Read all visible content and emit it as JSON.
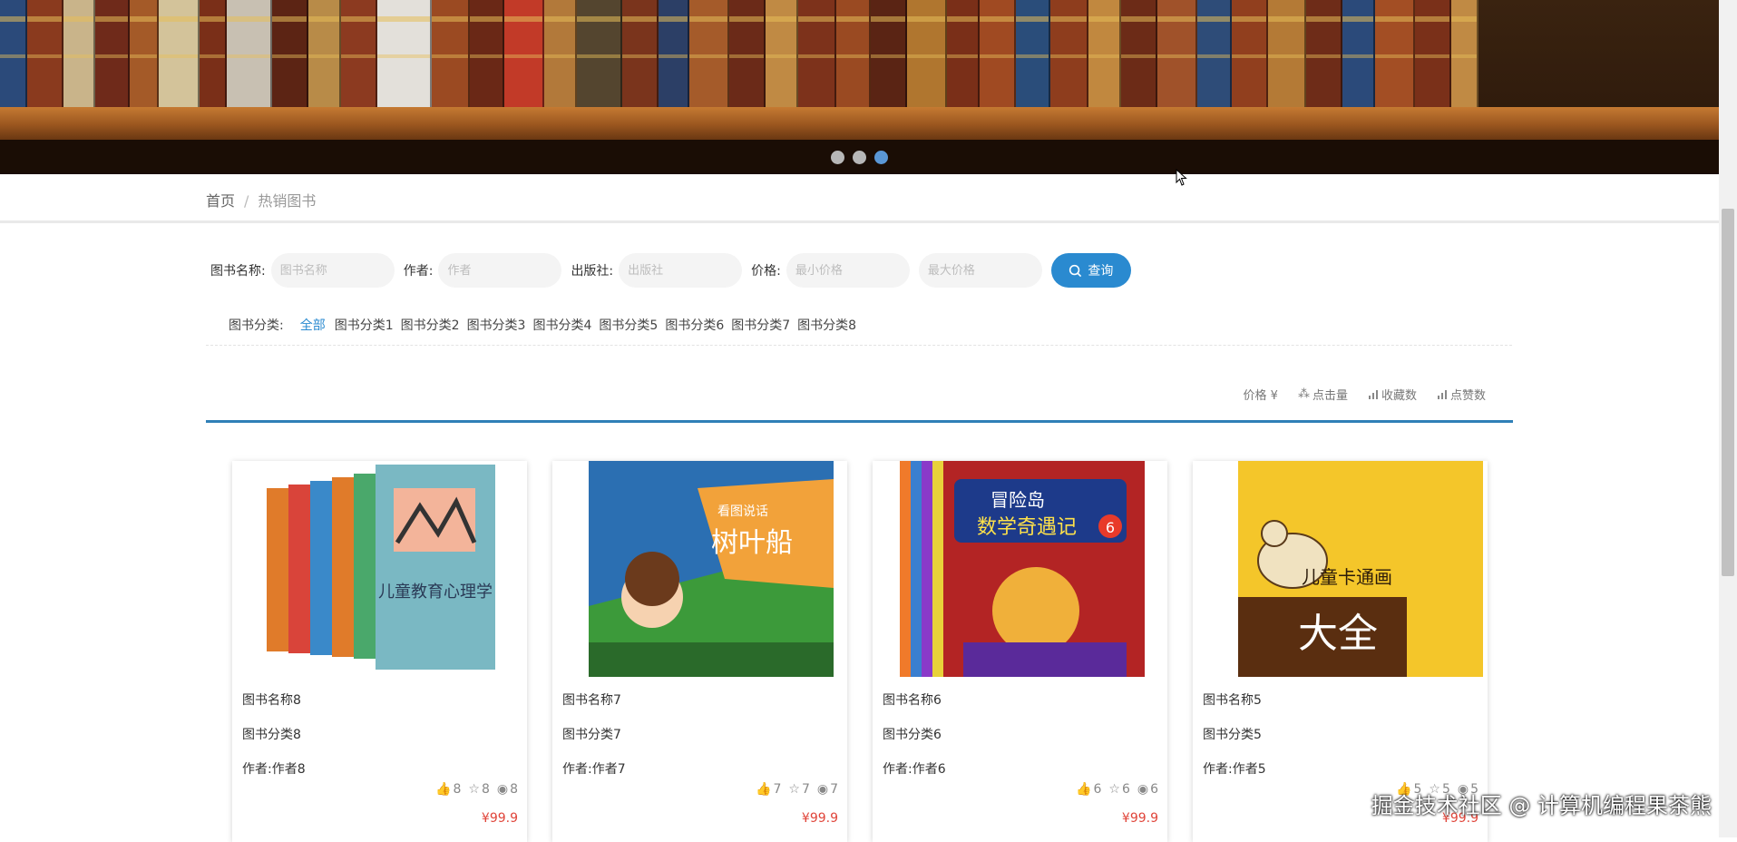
{
  "breadcrumb": {
    "home": "首页",
    "separator": "/",
    "current": "热销图书"
  },
  "carousel": {
    "slides": 3,
    "active_index": 2
  },
  "search": {
    "name_label": "图书名称:",
    "name_placeholder": "图书名称",
    "author_label": "作者:",
    "author_placeholder": "作者",
    "publisher_label": "出版社:",
    "publisher_placeholder": "出版社",
    "price_label": "价格:",
    "min_price_placeholder": "最小价格",
    "max_price_placeholder": "最大价格",
    "button_label": "查询"
  },
  "categories": {
    "label": "图书分类:",
    "items": [
      "全部",
      "图书分类1",
      "图书分类2",
      "图书分类3",
      "图书分类4",
      "图书分类5",
      "图书分类6",
      "图书分类7",
      "图书分类8"
    ],
    "active": "全部"
  },
  "sort": {
    "price": "价格 ¥",
    "clicks": "点击量",
    "favorites": "收藏数",
    "likes": "点赞数"
  },
  "books": [
    {
      "name": "图书名称8",
      "category": "图书分类8",
      "author": "作者:作者8",
      "likes": "8",
      "favorites": "8",
      "views": "8",
      "price": "¥99.9",
      "cover_title": "儿童教育心理学"
    },
    {
      "name": "图书名称7",
      "category": "图书分类7",
      "author": "作者:作者7",
      "likes": "7",
      "favorites": "7",
      "views": "7",
      "price": "¥99.9",
      "cover_title": "树叶船",
      "cover_subtitle": "看图说话"
    },
    {
      "name": "图书名称6",
      "category": "图书分类6",
      "author": "作者:作者6",
      "likes": "6",
      "favorites": "6",
      "views": "6",
      "price": "¥99.9",
      "cover_title": "冒险岛",
      "cover_subtitle": "数学奇遇记",
      "cover_number": "6"
    },
    {
      "name": "图书名称5",
      "category": "图书分类5",
      "author": "作者:作者5",
      "likes": "5",
      "favorites": "5",
      "views": "5",
      "price": "¥99.9",
      "cover_title": "儿童卡通画",
      "cover_subtitle": "大全"
    }
  ],
  "watermark": "掘金技术社区 @ 计算机编程果茶熊"
}
